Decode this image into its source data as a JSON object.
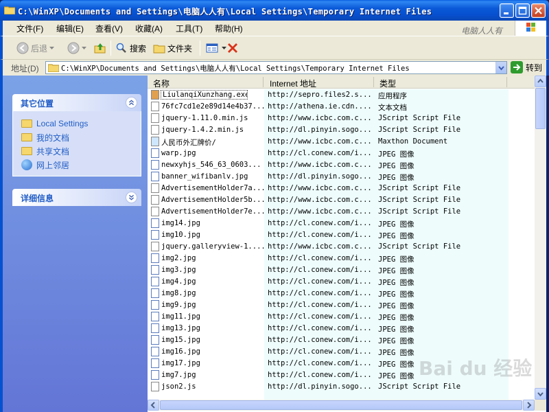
{
  "window": {
    "title": "C:\\WinXP\\Documents and Settings\\电脑人人有\\Local Settings\\Temporary Internet Files",
    "watermark_title": "电脑人人有"
  },
  "menu": [
    "文件(F)",
    "编辑(E)",
    "查看(V)",
    "收藏(A)",
    "工具(T)",
    "帮助(H)"
  ],
  "toolbar": {
    "back": "后退",
    "search": "搜索",
    "folders": "文件夹"
  },
  "address": {
    "label": "地址(D)",
    "value": "C:\\WinXP\\Documents and Settings\\电脑人人有\\Local Settings\\Temporary Internet Files",
    "go_label": "转到"
  },
  "sidebar": {
    "other_places": {
      "title": "其它位置",
      "items": [
        "Local Settings",
        "我的文档",
        "共享文档",
        "网上邻居"
      ]
    },
    "details": {
      "title": "详细信息"
    }
  },
  "list": {
    "columns": [
      "名称",
      "Internet 地址",
      "类型"
    ],
    "rows": [
      {
        "name": "LiulanqiXunzhang.exe",
        "url": "http://sepro.files2.s...",
        "type": "应用程序"
      },
      {
        "name": "76fc7cd1e2e89d14e4b37...",
        "url": "http://athena.ie.cdn....",
        "type": "文本文档"
      },
      {
        "name": "jquery-1.11.0.min.js",
        "url": "http://www.icbc.com.c...",
        "type": "JScript Script File"
      },
      {
        "name": "jquery-1.4.2.min.js",
        "url": "http://dl.pinyin.sogo...",
        "type": "JScript Script File"
      },
      {
        "name": "人民币外汇牌价/",
        "url": "http://www.icbc.com.c...",
        "type": "Maxthon Document"
      },
      {
        "name": "warp.jpg",
        "url": "http://cl.conew.com/i...",
        "type": "JPEG 图像"
      },
      {
        "name": "newxyhjs_546_63_0603...",
        "url": "http://www.icbc.com.c...",
        "type": "JPEG 图像"
      },
      {
        "name": "banner_wifibanlv.jpg",
        "url": "http://dl.pinyin.sogo...",
        "type": "JPEG 图像"
      },
      {
        "name": "AdvertisementHolder7a...",
        "url": "http://www.icbc.com.c...",
        "type": "JScript Script File"
      },
      {
        "name": "AdvertisementHolder5b...",
        "url": "http://www.icbc.com.c...",
        "type": "JScript Script File"
      },
      {
        "name": "AdvertisementHolder7e...",
        "url": "http://www.icbc.com.c...",
        "type": "JScript Script File"
      },
      {
        "name": "img14.jpg",
        "url": "http://cl.conew.com/i...",
        "type": "JPEG 图像"
      },
      {
        "name": "img10.jpg",
        "url": "http://cl.conew.com/i...",
        "type": "JPEG 图像"
      },
      {
        "name": "jquery.galleryview-1....",
        "url": "http://www.icbc.com.c...",
        "type": "JScript Script File"
      },
      {
        "name": "img2.jpg",
        "url": "http://cl.conew.com/i...",
        "type": "JPEG 图像"
      },
      {
        "name": "img3.jpg",
        "url": "http://cl.conew.com/i...",
        "type": "JPEG 图像"
      },
      {
        "name": "img4.jpg",
        "url": "http://cl.conew.com/i...",
        "type": "JPEG 图像"
      },
      {
        "name": "img8.jpg",
        "url": "http://cl.conew.com/i...",
        "type": "JPEG 图像"
      },
      {
        "name": "img9.jpg",
        "url": "http://cl.conew.com/i...",
        "type": "JPEG 图像"
      },
      {
        "name": "img11.jpg",
        "url": "http://cl.conew.com/i...",
        "type": "JPEG 图像"
      },
      {
        "name": "img13.jpg",
        "url": "http://cl.conew.com/i...",
        "type": "JPEG 图像"
      },
      {
        "name": "img15.jpg",
        "url": "http://cl.conew.com/i...",
        "type": "JPEG 图像"
      },
      {
        "name": "img16.jpg",
        "url": "http://cl.conew.com/i...",
        "type": "JPEG 图像"
      },
      {
        "name": "img17.jpg",
        "url": "http://cl.conew.com/i...",
        "type": "JPEG 图像"
      },
      {
        "name": "img7.jpg",
        "url": "http://cl.conew.com/i...",
        "type": "JPEG 图像"
      },
      {
        "name": "json2.js",
        "url": "http://dl.pinyin.sogo...",
        "type": "JScript Script File"
      }
    ]
  },
  "watermark": "Bai du 经验"
}
